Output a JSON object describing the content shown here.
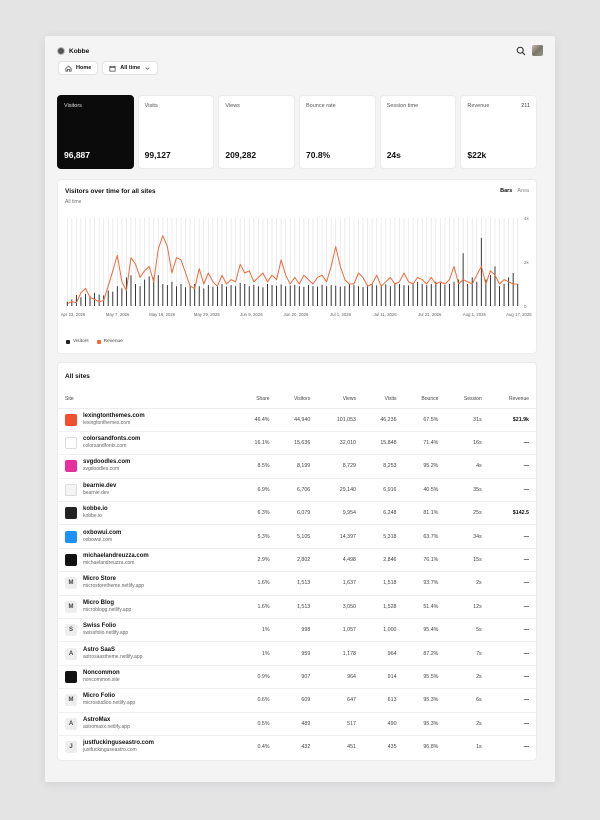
{
  "header": {
    "brand": "Kobbe",
    "home_label": "Home",
    "range_label": "All time"
  },
  "stats": [
    {
      "label": "Visitors",
      "value": "96,887",
      "extra": ""
    },
    {
      "label": "Visits",
      "value": "99,127",
      "extra": ""
    },
    {
      "label": "Views",
      "value": "209,282",
      "extra": ""
    },
    {
      "label": "Bounce rate",
      "value": "70.8%",
      "extra": ""
    },
    {
      "label": "Session time",
      "value": "24s",
      "extra": ""
    },
    {
      "label": "Revenue",
      "value": "$22k",
      "extra": "211"
    }
  ],
  "chart": {
    "title": "Visitors over time for all sites",
    "subtitle": "All time",
    "toggle_bars": "Bars",
    "toggle_area": "Area",
    "legend_visitors": "Visitors",
    "legend_revenue": "Revenue"
  },
  "chart_data": {
    "type": "bar",
    "y_ticks": [
      "4k",
      "2k",
      "0"
    ],
    "ylim": [
      0,
      4000
    ],
    "x_tick_labels": [
      "Apr 23, 2026",
      "May 7, 2026",
      "May 16, 2026",
      "May 29, 2026",
      "Jun 9, 2026",
      "Jun 20, 2026",
      "Jul 1, 2026",
      "Jul 11, 2026",
      "Jul 21, 2026",
      "Aug 1, 2026",
      "Aug 17, 2026"
    ],
    "series": [
      {
        "name": "Visitors",
        "color": "#222222",
        "values": [
          200,
          300,
          500,
          400,
          550,
          450,
          600,
          520,
          480,
          700,
          650,
          900,
          800,
          1300,
          1400,
          1000,
          900,
          1200,
          1350,
          1300,
          1400,
          1000,
          950,
          1100,
          900,
          1000,
          850,
          950,
          1000,
          900,
          800,
          950,
          880,
          900,
          1000,
          880,
          950,
          900,
          1050,
          1000,
          900,
          960,
          900,
          850,
          1000,
          950,
          920,
          980,
          900,
          930,
          960,
          900,
          870,
          950,
          900,
          880,
          960,
          900,
          950,
          920,
          880,
          900,
          980,
          950,
          900,
          860,
          950,
          990,
          940,
          900,
          980,
          900,
          1050,
          1000,
          950,
          930,
          1000,
          1100,
          1000,
          950,
          1000,
          1100,
          1050,
          950,
          1000,
          1100,
          1200,
          2400,
          1000,
          1300,
          1100,
          3100,
          1200,
          1400,
          1800,
          900,
          1000,
          1300,
          1500,
          1000
        ]
      },
      {
        "name": "Revenue",
        "color": "#f06a3a",
        "values": [
          100,
          200,
          150,
          600,
          800,
          400,
          300,
          200,
          250,
          900,
          1600,
          2300,
          1100,
          700,
          2200,
          1900,
          1300,
          1600,
          1800,
          1100,
          2600,
          3200,
          2700,
          1500,
          2200,
          2100,
          1500,
          900,
          800,
          1700,
          1000,
          1500,
          1100,
          900,
          1400,
          1000,
          1200,
          1100,
          1900,
          1500,
          1600,
          1100,
          1300,
          1500,
          1100,
          1400,
          1200,
          2100,
          1400,
          1000,
          1300,
          1000,
          1400,
          1200,
          1000,
          1300,
          1400,
          1100,
          1800,
          2700,
          1800,
          1200,
          1000,
          1000,
          1500,
          1300,
          900,
          1000,
          1400,
          900,
          1100,
          1300,
          1000,
          1100,
          1500,
          1100,
          1000,
          1300,
          1200,
          1000,
          1300,
          1000,
          1100,
          1000,
          1200,
          1800,
          1000,
          1200,
          1100,
          1000,
          1400,
          1800,
          1000,
          1600,
          1400,
          1000,
          1200,
          1100,
          1000,
          1000
        ]
      }
    ]
  },
  "table": {
    "title": "All sites",
    "columns": [
      "Site",
      "Share",
      "Visitors",
      "Views",
      "Visits",
      "Bounce",
      "Session",
      "Revenue"
    ],
    "rows": [
      {
        "name": "lexingtonthemes.com",
        "url": "lexingtonthemes.com",
        "share": "46.4%",
        "visitors": "44,940",
        "views": "101,053",
        "visits": "46,236",
        "bounce": "67.5%",
        "session": "31s",
        "revenue": "$21.9k",
        "fav_color": "#f0502d",
        "fav_text": "",
        "fav_fg": "#fff"
      },
      {
        "name": "colorsandfonts.com",
        "url": "colorsandfonts.com",
        "share": "16.1%",
        "visitors": "15,636",
        "views": "32,010",
        "visits": "15,848",
        "bounce": "71.4%",
        "session": "16s",
        "revenue": "—",
        "fav_color": "#ffffff",
        "fav_text": "",
        "fav_fg": "#111"
      },
      {
        "name": "svgdoodles.com",
        "url": "svgdoodles.com",
        "share": "8.5%",
        "visitors": "8,199",
        "views": "8,729",
        "visits": "8,253",
        "bounce": "95.2%",
        "session": "4s",
        "revenue": "—",
        "fav_color": "#e82f9e",
        "fav_text": "",
        "fav_fg": "#fff"
      },
      {
        "name": "bearnie.dev",
        "url": "bearnie.dev",
        "share": "6.9%",
        "visitors": "6,706",
        "views": "29,140",
        "visits": "6,916",
        "bounce": "40.5%",
        "session": "35s",
        "revenue": "—",
        "fav_color": "#f4f4f5",
        "fav_text": "",
        "fav_fg": "#444"
      },
      {
        "name": "kobbe.io",
        "url": "kobbe.io",
        "share": "6.3%",
        "visitors": "6,079",
        "views": "9,954",
        "visits": "6,248",
        "bounce": "81.1%",
        "session": "25s",
        "revenue": "$142.5",
        "fav_color": "#222222",
        "fav_text": "",
        "fav_fg": "#fff"
      },
      {
        "name": "oxbowui.com",
        "url": "oxbowui.com",
        "share": "5.3%",
        "visitors": "5,105",
        "views": "14,397",
        "visits": "5,318",
        "bounce": "63.7%",
        "session": "34s",
        "revenue": "—",
        "fav_color": "#1e90ff",
        "fav_text": "",
        "fav_fg": "#fff"
      },
      {
        "name": "michaelandreuzza.com",
        "url": "michaelandreuzza.com",
        "share": "2.9%",
        "visitors": "2,802",
        "views": "4,498",
        "visits": "2,846",
        "bounce": "76.1%",
        "session": "15s",
        "revenue": "—",
        "fav_color": "#111111",
        "fav_text": "",
        "fav_fg": "#fff"
      },
      {
        "name": "Micro Store",
        "url": "microstoretheme.netlify.app",
        "share": "1.6%",
        "visitors": "1,513",
        "views": "1,637",
        "visits": "1,518",
        "bounce": "93.7%",
        "session": "2s",
        "revenue": "—",
        "fav_color": "#eeeeee",
        "fav_text": "M",
        "fav_fg": "#444"
      },
      {
        "name": "Micro Blog",
        "url": "microblogg.netlify.app",
        "share": "1.6%",
        "visitors": "1,513",
        "views": "3,050",
        "visits": "1,528",
        "bounce": "51.4%",
        "session": "12s",
        "revenue": "—",
        "fav_color": "#eeeeee",
        "fav_text": "M",
        "fav_fg": "#444"
      },
      {
        "name": "Swiss Folio",
        "url": "swissfolio.netlify.app",
        "share": "1%",
        "visitors": "998",
        "views": "1,057",
        "visits": "1,000",
        "bounce": "95.4%",
        "session": "5s",
        "revenue": "—",
        "fav_color": "#eeeeee",
        "fav_text": "S",
        "fav_fg": "#444"
      },
      {
        "name": "Astro SaaS",
        "url": "astrosaastheme.netlify.app",
        "share": "1%",
        "visitors": "959",
        "views": "1,178",
        "visits": "964",
        "bounce": "87.2%",
        "session": "7s",
        "revenue": "—",
        "fav_color": "#eeeeee",
        "fav_text": "A",
        "fav_fg": "#444"
      },
      {
        "name": "Noncommon",
        "url": "noncommon.site",
        "share": "0.9%",
        "visitors": "907",
        "views": "964",
        "visits": "914",
        "bounce": "95.5%",
        "session": "2s",
        "revenue": "—",
        "fav_color": "#111111",
        "fav_text": "",
        "fav_fg": "#fff"
      },
      {
        "name": "Micro Folio",
        "url": "microstudioo.netlify.app",
        "share": "0.6%",
        "visitors": "609",
        "views": "647",
        "visits": "613",
        "bounce": "95.3%",
        "session": "6s",
        "revenue": "—",
        "fav_color": "#eeeeee",
        "fav_text": "M",
        "fav_fg": "#444"
      },
      {
        "name": "AstroMax",
        "url": "astromaxx.netlify.app",
        "share": "0.5%",
        "visitors": "489",
        "views": "517",
        "visits": "490",
        "bounce": "95.3%",
        "session": "2s",
        "revenue": "—",
        "fav_color": "#eeeeee",
        "fav_text": "A",
        "fav_fg": "#444"
      },
      {
        "name": "justfuckinguseastro.com",
        "url": "justfuckinguseastro.com",
        "share": "0.4%",
        "visitors": "432",
        "views": "451",
        "visits": "435",
        "bounce": "96.8%",
        "session": "1s",
        "revenue": "—",
        "fav_color": "#eeeeee",
        "fav_text": "J",
        "fav_fg": "#444"
      }
    ]
  }
}
